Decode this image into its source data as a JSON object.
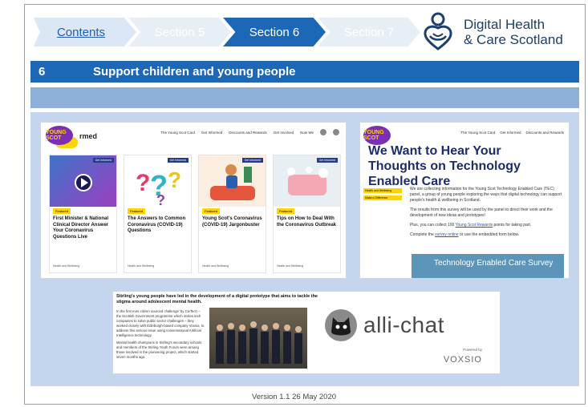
{
  "nav": {
    "contents": "Contents",
    "section5": "Section 5",
    "section6": "Section 6",
    "section7": "Section 7"
  },
  "logo": {
    "line1": "Digital Health",
    "line2": "& Care Scotland"
  },
  "section": {
    "number": "6",
    "title": "Support children and young people"
  },
  "young_scot": {
    "logo": "YOUNG SCOT",
    "heading_fragment": "rmed",
    "nav": [
      "The Young Scot Card",
      "Get Informed",
      "Discounts and Rewards",
      "Get Involved",
      "Now We"
    ],
    "cards": [
      {
        "tag": "Get Informed",
        "badge": "Featured",
        "title": "First Minister & National Clinical Director Answer Your Coronavirus Questions Live",
        "footer": "Health and Wellbeing"
      },
      {
        "tag": "Get Informed",
        "badge": "Featured",
        "title": "The Answers to Common Coronavirus (COVID-19) Questions",
        "footer": "Health and Wellbeing"
      },
      {
        "tag": "Get Informed",
        "badge": "Featured",
        "title": "Young Scot's Coronavirus (COVID-19) Jargonbuster",
        "footer": "Health and Wellbeing"
      },
      {
        "tag": "Get Informed",
        "badge": "Featured",
        "title": "Tips on How to Deal With the Coronavirus Outbreak",
        "footer": "Health and Wellbeing"
      }
    ]
  },
  "tec": {
    "nav": [
      "The Young Scot Card",
      "Get Informed",
      "Discounts and Rewards"
    ],
    "title": "We Want to Hear Your Thoughts on Technology Enabled Care",
    "tags": [
      "Health and Wellbeing",
      "Make a Difference"
    ],
    "p1": "We are collecting information for the Young Scot Technology Enabled Care (TEC) panel, a group of young people exploring the ways that digital technology can support people's health & wellbeing in Scotland.",
    "p2": "The results from this survey will be used by the panel to direct their work and the development of new ideas and prototypes!",
    "p3_pre": "Plus, you can collect 100 ",
    "p3_link": "Young Scot Rewards",
    "p3_post": " points for taking part.",
    "p4_pre": "Complete the ",
    "p4_link": "survey online",
    "p4_post": " or use the embedded form below.",
    "button": "Technology Enabled Care Survey"
  },
  "alli": {
    "headline": "Stirling's young people have led in the development of a digital prototype that aims to tackle the stigma around adolescent mental health.",
    "p1": "In the first ever citizen sourced challenge' by CivTech – the Scottish Government programme which invites tech companies to solve public sector challenges – they worked closely with Edinburgh-based company Voxsio, to address this serious issue using conversational Artificial Intelligence technology.",
    "p2": "Mental health champions in Stirling's secondary schools and members of the Stirling Youth Forum were among those involved in the pioneering project, which started seven months ago.",
    "brand": "alli-chat",
    "powered_by": "Powered by",
    "company": "VOXSIO"
  },
  "footer": "Version 1.1 26 May 2020",
  "colors": {
    "primary": "#1c68b7",
    "panel": "#c3d6ee",
    "subbar": "#8fb1d9"
  }
}
